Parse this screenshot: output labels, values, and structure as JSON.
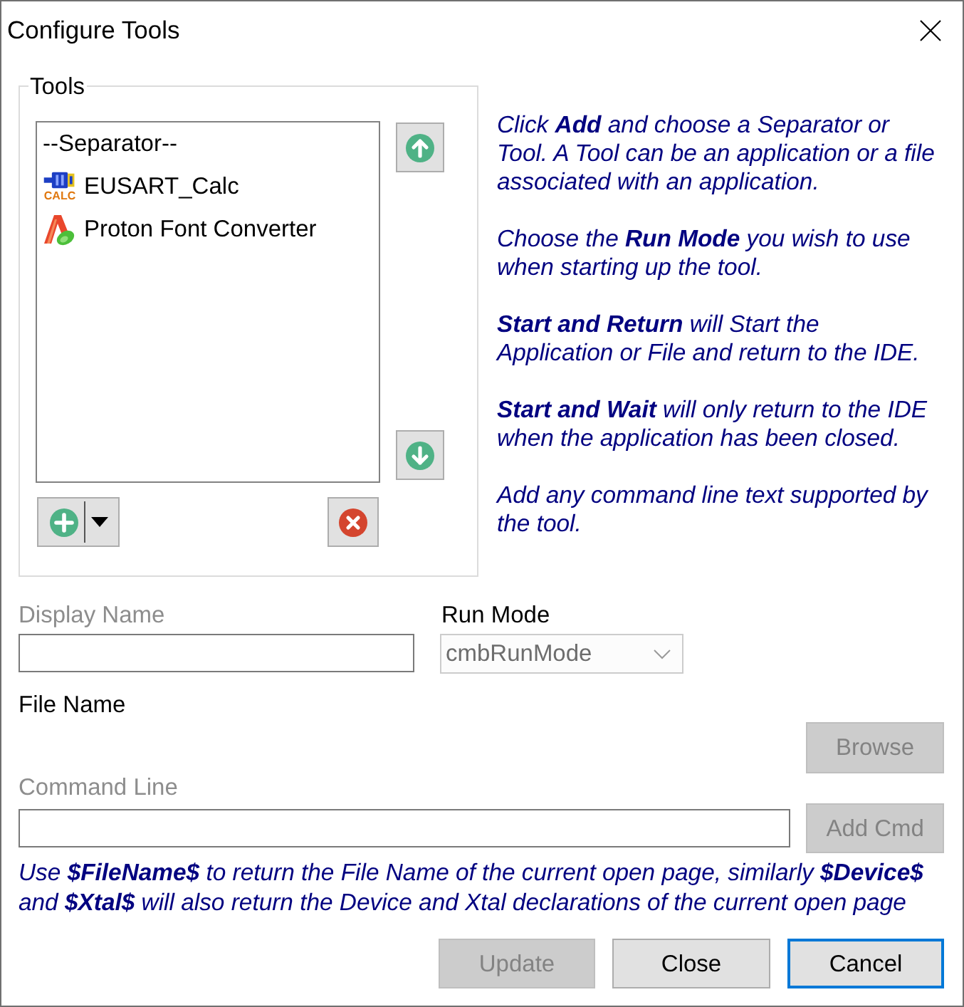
{
  "window": {
    "title": "Configure Tools"
  },
  "tools_group": {
    "label": "Tools",
    "items": [
      {
        "kind": "separator",
        "label": "--Separator--",
        "selected": false
      },
      {
        "kind": "tool",
        "label": "EUSART_Calc",
        "icon_caption": "CALC",
        "selected": false
      },
      {
        "kind": "tool",
        "label": "Proton Font Converter",
        "selected": false
      }
    ]
  },
  "help": [
    "Click **Add** and choose a Separator or Tool. A Tool can be an application or a file associated with an application.",
    "Choose the **Run Mode** you wish to use when starting up the tool.",
    "**Start and Return** will Start the Application or File and return to the IDE.",
    "**Start and Wait** will only return to the IDE when the application has been closed.",
    "Add any command line text supported by the tool."
  ],
  "display_name": {
    "label": "Display Name",
    "label_disabled": true
  },
  "run_mode": {
    "label": "Run Mode",
    "label_disabled": false,
    "value": "cmbRunMode",
    "disabled": true
  },
  "file_name": {
    "label": "File Name",
    "label_disabled": false
  },
  "browse_button": {
    "label": "Browse",
    "disabled": true
  },
  "command_line": {
    "label": "Command Line",
    "label_disabled": true
  },
  "add_cmd_button": {
    "label": "Add Cmd",
    "disabled": true
  },
  "hint": "Use **$FileName$** to return the File Name of the current open page, similarly **$Device$** and **$Xtal$** will also return the Device and Xtal declarations of the current open page",
  "buttons": [
    {
      "label": "Update",
      "disabled": true,
      "default": false
    },
    {
      "label": "Close",
      "disabled": false,
      "default": false
    },
    {
      "label": "Cancel",
      "disabled": false,
      "default": true
    }
  ]
}
